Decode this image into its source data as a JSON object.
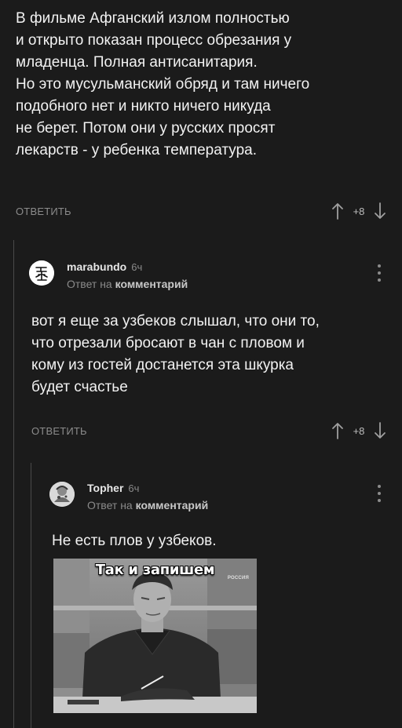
{
  "comments": [
    {
      "lines": [
        "В фильме Афганский излом полностью",
        "и открыто показан процесс обрезания у",
        "младенца. Полная антисанитария.",
        "Но это мусульманский обряд и там ничего",
        "подобного нет и никто ничего никуда",
        "не берет. Потом они у русских просят",
        "лекарств - у ребенка температура."
      ],
      "reply_label": "ОТВЕТИТЬ",
      "votes": "+8"
    },
    {
      "author": "marabundo",
      "time": "6ч",
      "reply_prefix": "Ответ на",
      "reply_target": "комментарий",
      "lines": [
        "вот я еще за узбеков слышал, что они то,",
        "что отрезали бросают в чан с пловом и",
        "кому из гостей достанется эта шкурка",
        "будет счастье"
      ],
      "reply_label": "ОТВЕТИТЬ",
      "votes": "+8"
    },
    {
      "author": "Topher",
      "time": "6ч",
      "reply_prefix": "Ответ на",
      "reply_target": "комментарий",
      "lines": [
        "Не есть плов у узбеков."
      ],
      "meme": {
        "caption": "Так и запишем",
        "watermark": "РОССИЯ"
      }
    }
  ],
  "icons": {
    "upvote": "arrow-up-icon",
    "downvote": "arrow-down-icon",
    "more": "more-vertical-icon"
  },
  "colors": {
    "background": "#1b1b1b",
    "text": "#f2f2f2",
    "muted": "#8c8c8c",
    "thread_line": "#4a4a4a"
  }
}
